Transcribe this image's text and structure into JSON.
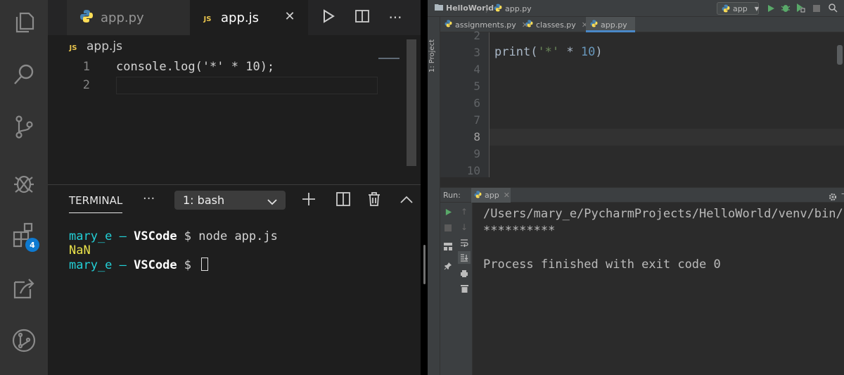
{
  "vscode": {
    "tabs": [
      {
        "label": "app.py",
        "active": false
      },
      {
        "label": "app.js",
        "active": true
      }
    ],
    "breadcrumb": {
      "file": "app.js",
      "icon_text": "JS"
    },
    "editor": {
      "lines": [
        {
          "number": "1",
          "text": "console.log('*' * 10);"
        },
        {
          "number": "2",
          "text": ""
        }
      ]
    },
    "activity_bar": {
      "items": [
        "files-icon",
        "search-icon",
        "source-control-icon",
        "debug-icon",
        "extensions-icon",
        "remote-icon",
        "git-graph-icon"
      ],
      "extensions_badge": "4"
    },
    "panel": {
      "terminal_tab": "TERMINAL",
      "more": "···",
      "terminal_select": "1: bash",
      "terminal_lines": [
        {
          "user": "mary_e",
          "sep": " – ",
          "host": "VSCode",
          "rest": " $ node app.js"
        },
        {
          "output": "NaN"
        },
        {
          "user": "mary_e",
          "sep": " – ",
          "host": "VSCode",
          "rest": " $ "
        }
      ]
    },
    "colors": {
      "accent_blue": "#0e7ad1",
      "terminal_user": "#23d0d7",
      "terminal_output": "#e9e14a"
    }
  },
  "pycharm": {
    "nav": {
      "project": "HelloWorld",
      "file": "app.py",
      "run_config": "app"
    },
    "sidebar_label": "1: Project",
    "tabs": [
      {
        "label": "assignments.py",
        "active": false
      },
      {
        "label": "classes.py",
        "active": false
      },
      {
        "label": "app.py",
        "active": true
      }
    ],
    "editor": {
      "line_numbers": [
        "2",
        "3",
        "4",
        "5",
        "6",
        "7",
        "8",
        "9",
        "10"
      ],
      "current_line": "8",
      "code": {
        "fn": "print",
        "open": "(",
        "str": "'*'",
        "op": " * ",
        "num": "10",
        "close": ")"
      }
    },
    "run": {
      "label": "Run:",
      "tab": "app",
      "output": [
        "/Users/mary_e/PycharmProjects/HelloWorld/venv/bin/py",
        "**********",
        "",
        "Process finished with exit code 0"
      ]
    }
  }
}
